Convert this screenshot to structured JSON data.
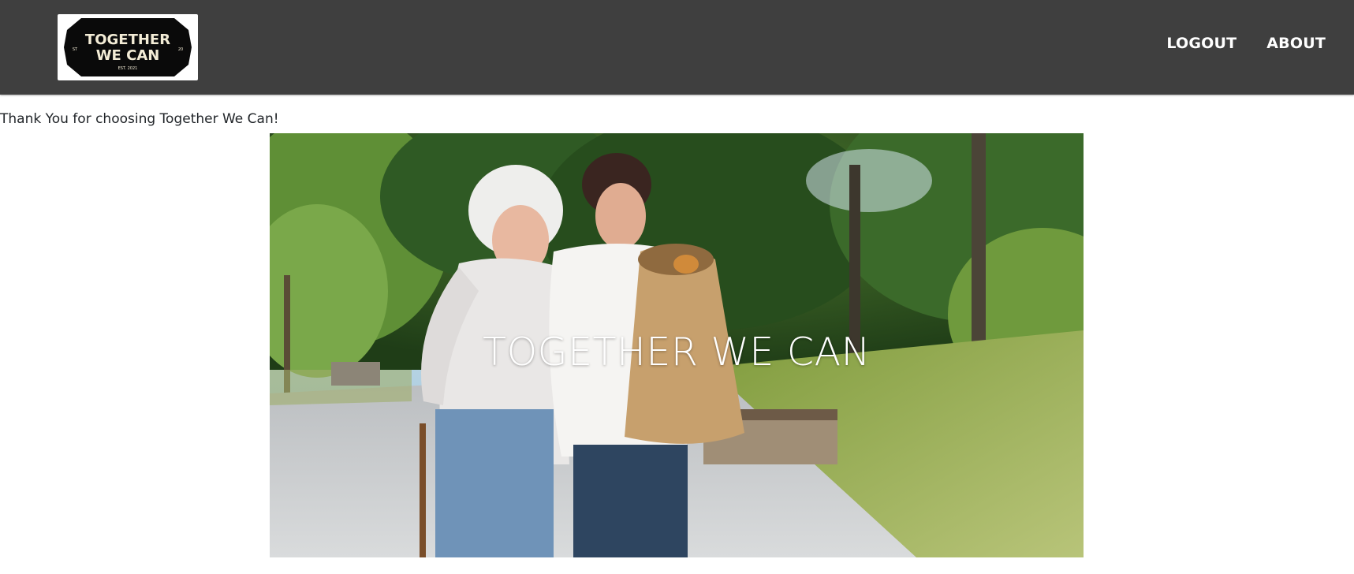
{
  "header": {
    "logo": {
      "line1": "TOGETHER",
      "line2": "WE CAN",
      "est": "EST. 2021",
      "side_left": "ST",
      "side_right": "20"
    },
    "nav": [
      {
        "label": "LOGOUT"
      },
      {
        "label": "ABOUT"
      }
    ]
  },
  "main": {
    "thank_you": "Thank You for choosing Together We Can!",
    "hero": {
      "title": "TOGETHER WE CAN",
      "image_alt": "young-woman-helping-elderly-woman-in-park"
    }
  },
  "colors": {
    "navbar_bg": "#3f3f3f",
    "nav_text": "#ffffff",
    "body_text": "#212529"
  }
}
